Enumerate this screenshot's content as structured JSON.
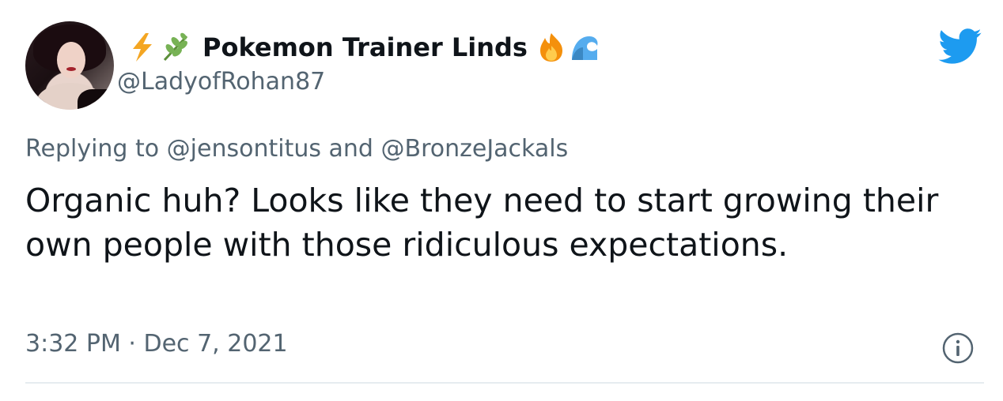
{
  "author": {
    "display_name": "Pokemon Trainer Linds",
    "handle": "@LadyofRohan87",
    "name_prefix_icons": [
      "lightning-icon",
      "herb-icon"
    ],
    "name_suffix_icons": [
      "fire-icon",
      "wave-icon"
    ]
  },
  "reply": {
    "text": "Replying to @jensontitus and @BronzeJackals"
  },
  "tweet": {
    "text": "Organic huh? Looks like they need to start growing their own people with those ridiculous expectations.",
    "timestamp": "3:32 PM · Dec 7, 2021"
  },
  "colors": {
    "twitter_blue": "#1d9bf0",
    "secondary_text": "#536471",
    "primary_text": "#0f1419",
    "divider": "#e6ecf0"
  }
}
